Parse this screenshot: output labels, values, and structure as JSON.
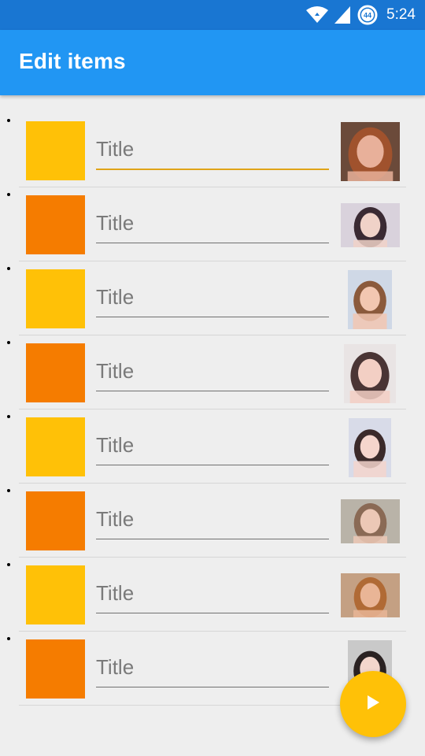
{
  "status_bar": {
    "time": "5:24",
    "battery_level": "44"
  },
  "app_bar": {
    "title": "Edit items"
  },
  "colors": {
    "primary": "#2196f3",
    "primary_dark": "#1976d2",
    "accent": "#ffc107",
    "amber": "#ffc107",
    "orange": "#f57c00",
    "background": "#eeeeee"
  },
  "items": [
    {
      "color": "#ffc107",
      "title_placeholder": "Title",
      "title_value": ""
    },
    {
      "color": "#f57c00",
      "title_placeholder": "Title",
      "title_value": ""
    },
    {
      "color": "#ffc107",
      "title_placeholder": "Title",
      "title_value": ""
    },
    {
      "color": "#f57c00",
      "title_placeholder": "Title",
      "title_value": ""
    },
    {
      "color": "#ffc107",
      "title_placeholder": "Title",
      "title_value": ""
    },
    {
      "color": "#f57c00",
      "title_placeholder": "Title",
      "title_value": ""
    },
    {
      "color": "#ffc107",
      "title_placeholder": "Title",
      "title_value": ""
    },
    {
      "color": "#f57c00",
      "title_placeholder": "Title",
      "title_value": ""
    }
  ],
  "fab": {
    "icon": "play-icon"
  }
}
